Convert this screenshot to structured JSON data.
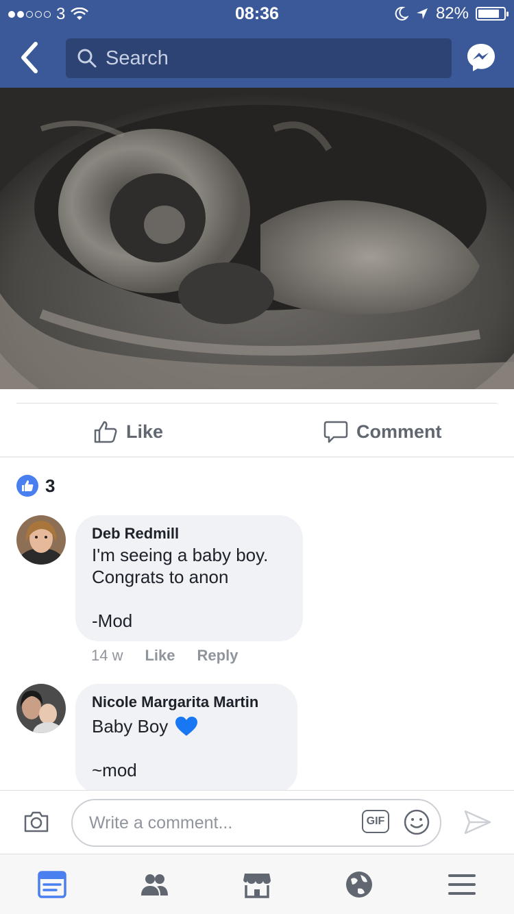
{
  "status_bar": {
    "carrier": "3",
    "time": "08:36",
    "battery": "82%",
    "battery_level": 0.82
  },
  "nav": {
    "search_placeholder": "Search"
  },
  "actions": {
    "like_label": "Like",
    "comment_label": "Comment"
  },
  "reactions": {
    "count": "3"
  },
  "comments": [
    {
      "author": "Deb Redmill",
      "text": "I'm seeing a baby boy.\nCongrats to anon\n\n-Mod",
      "time": "14 w",
      "like_label": "Like",
      "reply_label": "Reply"
    },
    {
      "author": "Nicole Margarita Martin",
      "text_main": "Baby Boy",
      "text_sign": "~mod"
    }
  ],
  "composer": {
    "placeholder": "Write a comment...",
    "gif_label": "GIF"
  },
  "colors": {
    "brand": "#3b5998",
    "like_blue": "#4a7ff0",
    "heart_blue": "#1877f2"
  }
}
